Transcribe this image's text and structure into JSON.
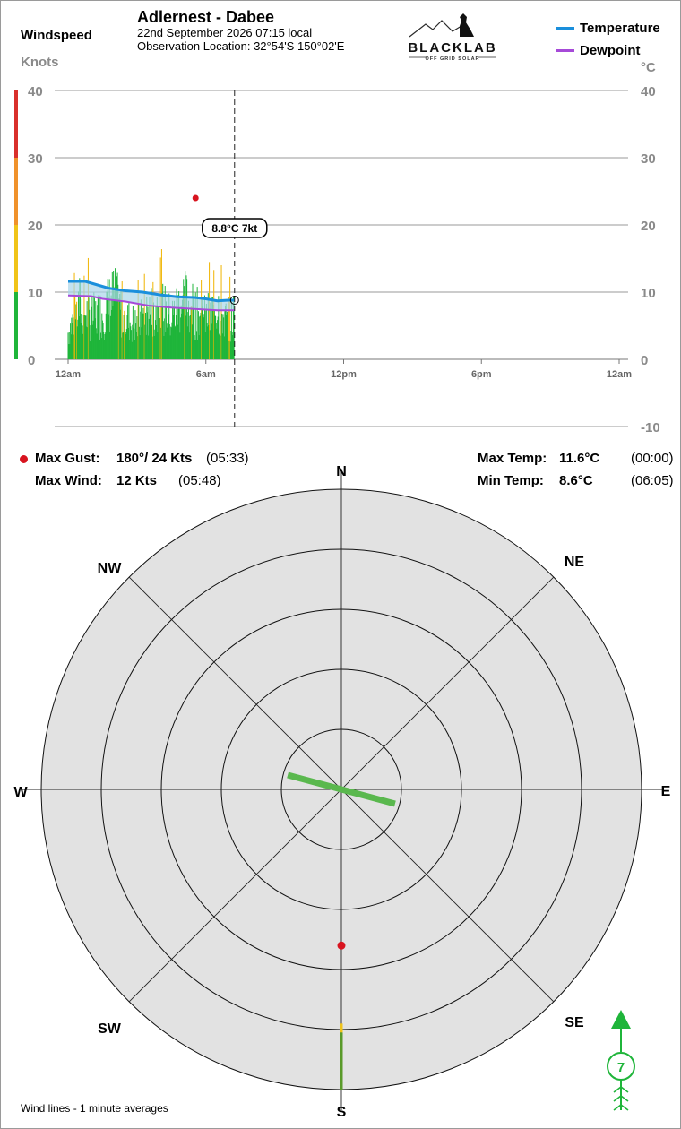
{
  "header": {
    "station": "Adlernest - Dabee",
    "date_line": "22nd September 2026  07:15 local",
    "location_line": "Observation Location:  32°54'S 150°02'E",
    "windspeed_label": "Windspeed",
    "units_left": "Knots",
    "units_right": "°C"
  },
  "logo": {
    "name": "BLACKLAB",
    "tagline": "OFF GRID SOLAR"
  },
  "legend": [
    {
      "label": "Temperature",
      "color": "#1a8fdc"
    },
    {
      "label": "Dewpoint",
      "color": "#a64ad8"
    }
  ],
  "chart_data": {
    "type": "line",
    "left_axis": {
      "label": "Knots",
      "range": [
        0,
        40
      ],
      "ticks": [
        "0",
        "10",
        "20",
        "30",
        "40"
      ]
    },
    "right_axis": {
      "label": "°C",
      "range": [
        -10,
        40
      ],
      "ticks": [
        "40",
        "30",
        "20",
        "10",
        "0",
        "-10"
      ]
    },
    "x_ticks": [
      "12am",
      "6am",
      "12pm",
      "6pm",
      "12am"
    ],
    "grid": true,
    "current_time": "07:15",
    "current_label": "8.8°C  7kt",
    "series": [
      {
        "name": "Temperature",
        "color": "#1a8fdc",
        "x": [
          "00:00",
          "00:45",
          "01:15",
          "01:45",
          "02:30",
          "03:15",
          "04:00",
          "04:45",
          "05:30",
          "06:00",
          "06:30",
          "07:00",
          "07:15"
        ],
        "values": [
          11.6,
          11.6,
          11.1,
          10.6,
          10.2,
          10.0,
          9.6,
          9.3,
          9.2,
          9.0,
          8.7,
          8.8,
          8.8
        ]
      },
      {
        "name": "Dewpoint",
        "color": "#a64ad8",
        "x": [
          "00:00",
          "01:00",
          "01:30",
          "02:30",
          "03:30",
          "04:30",
          "05:30",
          "06:30",
          "07:15"
        ],
        "values": [
          9.5,
          9.4,
          9.0,
          8.6,
          8.0,
          7.7,
          7.5,
          7.3,
          7.3
        ]
      },
      {
        "name": "Windspeed",
        "color": "#1fb53a",
        "x": [
          "00:00",
          "00:30",
          "01:00",
          "01:30",
          "02:00",
          "02:30",
          "03:00",
          "03:30",
          "04:00",
          "04:30",
          "05:00",
          "05:30",
          "06:00",
          "06:30",
          "07:00",
          "07:15"
        ],
        "values": [
          4,
          8,
          6,
          7,
          9,
          6,
          5,
          7,
          8,
          6,
          9,
          7,
          6,
          8,
          5,
          7
        ]
      }
    ],
    "speed_bands": [
      {
        "range": [
          0,
          10
        ],
        "color": "#1fb53a"
      },
      {
        "range": [
          10,
          20
        ],
        "color": "#f0c419"
      },
      {
        "range": [
          20,
          30
        ],
        "color": "#f0922b"
      },
      {
        "range": [
          30,
          40
        ],
        "color": "#d9302c"
      }
    ],
    "max_gust_point": {
      "time": "05:33",
      "speed": 24,
      "color": "#d8141f"
    }
  },
  "stats": {
    "max_gust_label": "Max Gust:",
    "max_gust_value": "180°/  24 Kts",
    "max_gust_time": "(05:33)",
    "max_wind_label": "Max Wind:",
    "max_wind_value": "12 Kts",
    "max_wind_time": "(05:48)",
    "max_temp_label": "Max Temp:",
    "max_temp_value": "11.6°C",
    "max_temp_time": "(00:00)",
    "min_temp_label": "Min Temp:",
    "min_temp_value": "8.6°C",
    "min_temp_time": "(06:05)"
  },
  "compass": {
    "labels": [
      "N",
      "NE",
      "E",
      "SE",
      "S",
      "SW",
      "W",
      "NW"
    ],
    "rings": 5,
    "wind_line": {
      "from_deg": 105,
      "to_deg": 285,
      "color": "#5ab84e"
    },
    "gust_dot": {
      "direction_deg": 180,
      "color": "#d8141f"
    },
    "south_trace": {
      "colors": [
        "#f0c419",
        "#5a9a2a"
      ]
    }
  },
  "wind_barb": {
    "speed": "7",
    "color": "#1fb53a"
  },
  "footer": "Wind lines - 1 minute averages"
}
